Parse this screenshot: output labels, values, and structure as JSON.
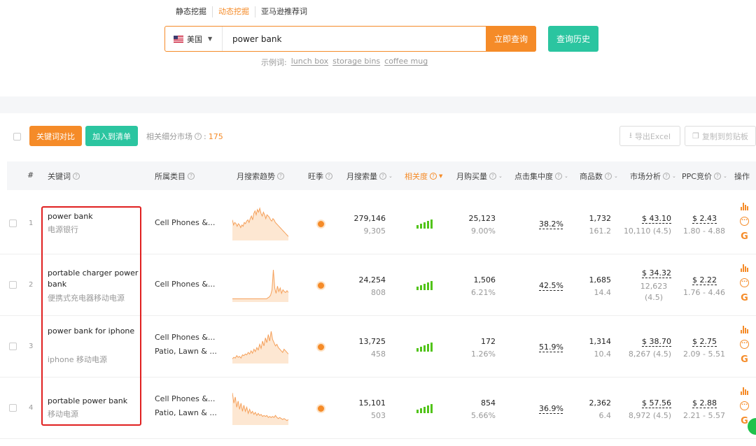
{
  "mode_tabs": [
    "静态挖掘",
    "动态挖掘",
    "亚马逊推荐词"
  ],
  "search": {
    "country": "美国",
    "query": "power bank",
    "submit_label": "立即查询",
    "history_label": "查询历史",
    "examples_label": "示例词:",
    "examples": [
      "lunch box",
      "storage bins",
      "coffee mug"
    ]
  },
  "toolbar": {
    "compare_label": "关键词对比",
    "add_list_label": "加入到清单",
    "related_label": "相关细分市场",
    "related_count": "175",
    "export_label": "导出Excel",
    "copy_label": "复制到剪贴板"
  },
  "columns": [
    "#",
    "关键词",
    "所属类目",
    "月搜索趋势",
    "旺季",
    "月搜索量",
    "相关度",
    "月购买量",
    "点击集中度",
    "商品数",
    "市场分析",
    "PPC竞价",
    "操作"
  ],
  "rows": [
    {
      "index": "1",
      "keyword": "power bank",
      "keyword_cn": "电源银行",
      "categories": [
        "Cell Phones &..."
      ],
      "search_volume": "279,146",
      "search_sub": "9,305",
      "purchases": "25,123",
      "purchase_rate": "9.00%",
      "click_concentration": "38.2%",
      "products": "1,732",
      "products_sub": "161.2",
      "market_price": "$ 43.10",
      "market_sub": "10,110 (4.5)",
      "ppc": "$ 2.43",
      "ppc_range": "1.80 - 4.88",
      "trend": [
        30,
        22,
        26,
        24,
        20,
        24,
        22,
        18,
        22,
        20,
        26,
        24,
        28,
        30,
        26,
        32,
        36,
        30,
        40,
        44,
        38,
        46,
        42,
        48,
        40,
        36,
        42,
        38,
        32,
        38,
        36,
        34,
        30,
        28,
        32,
        30,
        26,
        24,
        22,
        20,
        18,
        16,
        14,
        12,
        10,
        8,
        6,
        4
      ]
    },
    {
      "index": "2",
      "keyword": "portable charger power bank",
      "keyword_cn": "便携式充电器移动电源",
      "categories": [
        "Cell Phones &..."
      ],
      "search_volume": "24,254",
      "search_sub": "808",
      "purchases": "1,506",
      "purchase_rate": "6.21%",
      "click_concentration": "42.5%",
      "products": "1,685",
      "products_sub": "14.4",
      "market_price": "$ 34.32",
      "market_sub": "12,623 (4.5)",
      "ppc": "$ 2.22",
      "ppc_range": "1.76 - 4.46",
      "trend": [
        2,
        2,
        2,
        2,
        2,
        2,
        2,
        2,
        2,
        2,
        2,
        2,
        2,
        2,
        2,
        2,
        2,
        2,
        2,
        2,
        2,
        2,
        2,
        2,
        2,
        2,
        3,
        4,
        6,
        12,
        34,
        14,
        8,
        16,
        10,
        14,
        8,
        12,
        10,
        9,
        11,
        9
      ]
    },
    {
      "index": "3",
      "keyword": "power bank for iphone",
      "keyword_cn": "iphone 移动电源",
      "categories": [
        "Cell Phones &...",
        "Patio, Lawn & ..."
      ],
      "search_volume": "13,725",
      "search_sub": "458",
      "purchases": "172",
      "purchase_rate": "1.26%",
      "click_concentration": "51.9%",
      "products": "1,314",
      "products_sub": "10.4",
      "market_price": "$ 38.70",
      "market_sub": "8,267 (4.5)",
      "ppc": "$ 2.75",
      "ppc_range": "2.09 - 5.51",
      "trend": [
        4,
        6,
        5,
        8,
        6,
        7,
        5,
        9,
        8,
        10,
        9,
        12,
        10,
        14,
        11,
        16,
        13,
        18,
        15,
        22,
        17,
        26,
        20,
        30,
        24,
        34,
        26,
        38,
        28,
        24,
        20,
        22,
        18,
        16,
        14,
        12,
        16,
        14,
        12,
        10
      ]
    },
    {
      "index": "4",
      "keyword": "portable power bank",
      "keyword_cn": "移动电源",
      "categories": [
        "Cell Phones &...",
        "Patio, Lawn & ..."
      ],
      "search_volume": "15,101",
      "search_sub": "503",
      "purchases": "854",
      "purchase_rate": "5.66%",
      "click_concentration": "36.9%",
      "products": "2,362",
      "products_sub": "6.4",
      "market_price": "$ 57.56",
      "market_sub": "8,972 (4.5)",
      "ppc": "$ 2.88",
      "ppc_range": "2.21 - 5.57",
      "trend": [
        30,
        20,
        26,
        16,
        22,
        14,
        20,
        12,
        18,
        12,
        16,
        10,
        14,
        10,
        12,
        9,
        11,
        8,
        10,
        8,
        9,
        7,
        8,
        7,
        8,
        6,
        7,
        6,
        7,
        6,
        8,
        6,
        5,
        6,
        5,
        4,
        5,
        4,
        3,
        4
      ]
    }
  ],
  "colors": {
    "accent": "#f58b28",
    "teal": "#2bc5a0",
    "bar_green": "#52c41a",
    "highlight_red": "#e02020"
  }
}
